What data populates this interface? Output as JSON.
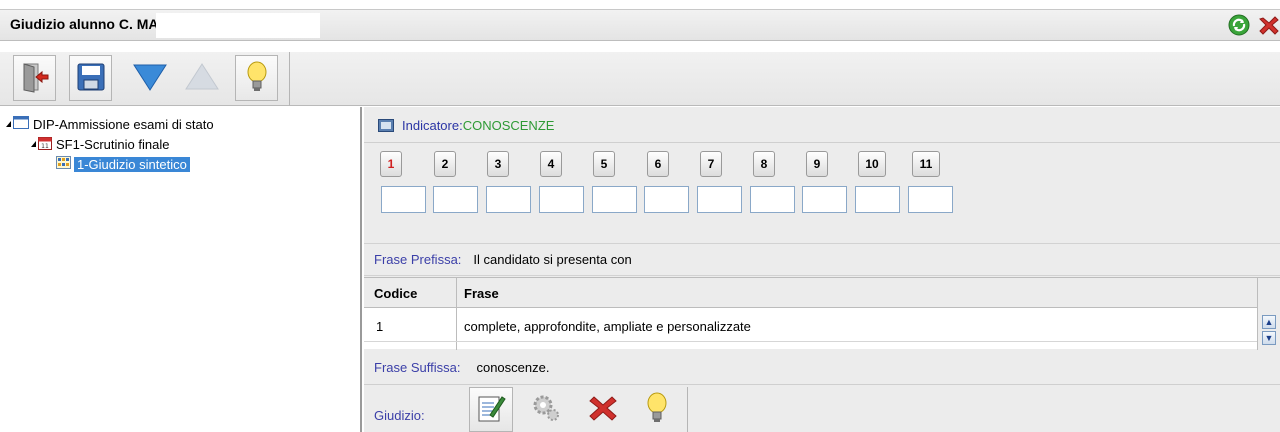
{
  "window": {
    "title": "Giudizio alunno C.  MANUEL"
  },
  "toolbar": {
    "buttons": [
      "exit-icon",
      "save-icon",
      "arrow-down-icon",
      "arrow-up-icon",
      "lightbulb-icon"
    ]
  },
  "tree": {
    "root": "DIP-Ammissione esami di stato",
    "child": "SF1-Scrutinio finale",
    "leaf": "1-Giudizio sintetico"
  },
  "indicatore": {
    "label": "Indicatore:",
    "value": "CONOSCENZE"
  },
  "numbers": [
    "1",
    "2",
    "3",
    "4",
    "5",
    "6",
    "7",
    "8",
    "9",
    "10",
    "11"
  ],
  "active_number": "1",
  "frase_prefissa": {
    "label": "Frase Prefissa:",
    "value": "Il candidato si presenta con"
  },
  "table": {
    "headers": [
      "Codice",
      "Frase"
    ],
    "rows": [
      {
        "codice": "1",
        "frase": "complete, approfondite, ampliate e personalizzate"
      }
    ]
  },
  "frase_suffissa": {
    "label": "Frase Suffissa:",
    "value": "conoscenze."
  },
  "giudizio": {
    "label": "Giudizio:"
  },
  "colors": {
    "accent_blue": "#3a87d6",
    "indicator_green": "#2e9a35",
    "label_blue": "#3b3fa8",
    "active_red": "#d02020"
  }
}
